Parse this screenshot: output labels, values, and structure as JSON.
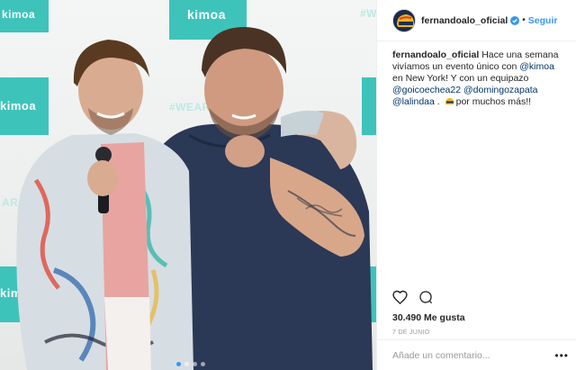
{
  "photo": {
    "alt": "",
    "wall_brand": "kimoa",
    "wall_hashtag": "#WEARE",
    "wall_hashtag_right": "#W",
    "wall_small_left": "AR",
    "carousel": {
      "count": 4,
      "active": 1
    }
  },
  "header": {
    "username": "fernandoalo_oficial",
    "bullet": "•",
    "follow_label": "Seguir"
  },
  "caption": {
    "username": "fernandoalo_oficial",
    "text_1": " Hace una semana vivíamos un evento único con ",
    "mention_1": "@kimoa",
    "text_2": " en New York! Y con un equipazo ",
    "mention_2": "@goicoechea22",
    "text_3": " ",
    "mention_3": "@domingozapata",
    "text_4": " ",
    "mention_4": "@lalindaa",
    "text_5": " . ",
    "text_6": "por muchos más!!"
  },
  "stats": {
    "likes": "30.490 Me gusta",
    "date": "7 DE JUNIO"
  },
  "comment": {
    "placeholder": "Añade un comentario...",
    "more_label": "•••"
  },
  "colors": {
    "accent": "#3897f0",
    "mention": "#003569",
    "brand_teal": "#3ec3bb",
    "secondary_text": "#999999"
  }
}
